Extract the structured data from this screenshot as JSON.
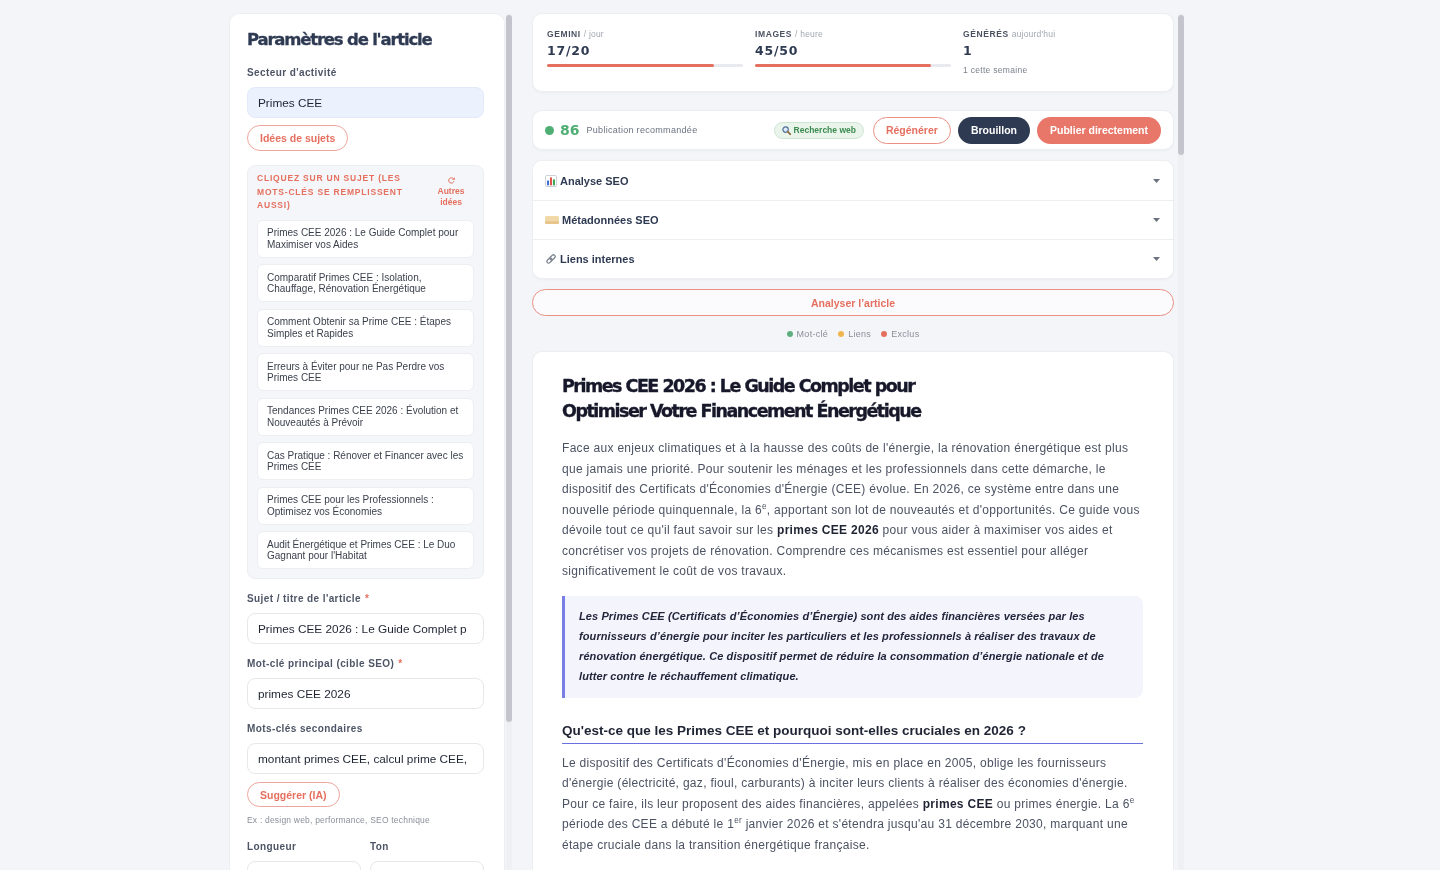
{
  "sidebar": {
    "title": "Paramètres de l'article",
    "sector": {
      "label": "Secteur d'activité",
      "value": "Primes CEE"
    },
    "ideas_button": "Idées de sujets",
    "suggestions": {
      "heading": "CLIQUEZ SUR UN SUJET (LES MOTS-CLÉS SE REMPLISSENT AUSSI)",
      "more_button": "Autres idées",
      "items": [
        "Primes CEE 2026 : Le Guide Complet pour Maximiser vos Aides",
        "Comparatif Primes CEE : Isolation, Chauffage, Rénovation Énergétique",
        "Comment Obtenir sa Prime CEE : Étapes Simples et Rapides",
        "Erreurs à Éviter pour ne Pas Perdre vos Primes CEE",
        "Tendances Primes CEE 2026 : Évolution et Nouveautés à Prévoir",
        "Cas Pratique : Rénover et Financer avec les Primes CEE",
        "Primes CEE pour les Professionnels : Optimisez vos Économies",
        "Audit Énergétique et Primes CEE : Le Duo Gagnant pour l'Habitat"
      ]
    },
    "fields": [
      {
        "label": "Sujet / titre de l'article",
        "marker": "*",
        "value": "Primes CEE 2026 : Le Guide Complet p"
      },
      {
        "label": "Mot-clé principal (cible SEO)",
        "marker": "*",
        "value": "primes CEE 2026"
      },
      {
        "label": "Mots-clés secondaires",
        "value": "montant primes CEE, calcul prime CEE,"
      }
    ],
    "suggest_button": "Suggérer (IA)",
    "hint": "Ex : design web, performance, SEO technique",
    "selects": [
      {
        "label": "Longueur"
      },
      {
        "label": "Ton"
      }
    ]
  },
  "stats": [
    {
      "kind": "quota",
      "name": "GEMINI",
      "unit": "/ jour",
      "value": "17/20",
      "level": 0.85
    },
    {
      "kind": "quota",
      "name": "IMAGES",
      "unit": "/ heure",
      "value": "45/50",
      "level": 0.9
    },
    {
      "kind": "count",
      "name": "GÉNÉRÉS",
      "unit": "aujourd'hui",
      "value": "1",
      "note": "1 cette semaine"
    }
  ],
  "toolbar": {
    "score": "86",
    "verdict": "Publication recommandée",
    "web_search": "Recherche web",
    "buttons": [
      {
        "label": "Régénérer",
        "kind": "outline"
      },
      {
        "label": "Brouillon",
        "kind": "dark"
      },
      {
        "label": "Publier directement",
        "kind": "primary"
      }
    ]
  },
  "panels": [
    {
      "title": "Analyse SEO",
      "kind": "analysis",
      "expanded": false
    },
    {
      "title": "Métadonnées SEO",
      "kind": "metadata",
      "expanded": false
    },
    {
      "title": "Liens internes",
      "kind": "links",
      "expanded": false
    }
  ],
  "analyze_button": "Analyser l’article",
  "legend": [
    {
      "label": "Mot-clé",
      "color": "#5fae7f"
    },
    {
      "label": "Liens",
      "color": "#f0b64d"
    },
    {
      "label": "Exclus",
      "color": "#e46e60"
    }
  ],
  "article": {
    "title": "Primes CEE 2026 : Le Guide Complet pour Optimiser Votre Financement Énergétique",
    "blocks": [
      {
        "kind": "paragraph",
        "text": "Face aux enjeux climatiques et à la hausse des coûts de l'énergie, la rénovation énergétique est plus que jamais une priorité. Pour soutenir les ménages et les professionnels dans cette démarche, le dispositif des Certificats d'Économies d'Énergie (CEE) évolue. En 2026, ce système entre dans une nouvelle période quinquennale, la 6$^{e}$, apportant son lot de nouveautés et d'opportunités. Ce guide vous dévoile tout ce qu'il faut savoir sur les **primes CEE 2026** pour vous aider à maximiser vos aides et concrétiser vos projets de rénovation. Comprendre ces mécanismes est essentiel pour alléger significativement le coût de vos travaux."
      },
      {
        "kind": "quote",
        "text": "Les Primes CEE (Certificats d’Économies d’Énergie) sont des aides financières versées par les fournisseurs d’énergie pour inciter les particuliers et les professionnels à réaliser des travaux de rénovation énergétique. Ce dispositif permet de réduire la consommation d’énergie nationale et de lutter contre le réchauffement climatique."
      },
      {
        "kind": "heading",
        "text": "Qu'est-ce que les Primes CEE et pourquoi sont-elles cruciales en 2026 ?"
      },
      {
        "kind": "paragraph",
        "text": "Le dispositif des Certificats d'Économies d'Énergie, mis en place en 2005, oblige les fournisseurs d'énergie (électricité, gaz, fioul, carburants) à inciter leurs clients à réaliser des économies d'énergie. Pour ce faire, ils leur proposent des aides financières, appelées **primes CEE** ou primes énergie. La 6$^{e}$ période des CEE a débuté le 1$^{er}$ janvier 2026 et s'étendra jusqu'au 31 décembre 2030, marquant une étape cruciale dans la transition énergétique française."
      }
    ]
  }
}
